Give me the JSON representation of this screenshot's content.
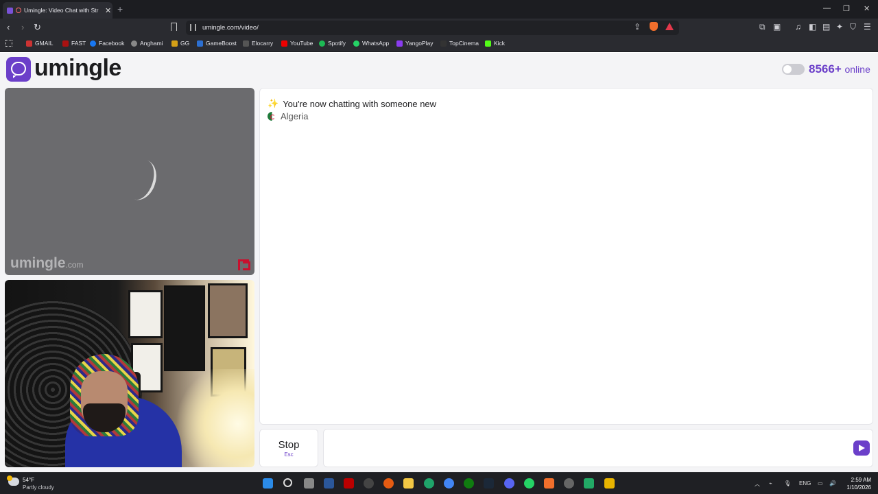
{
  "browser": {
    "tab_title": "Umingle: Video Chat with Str",
    "new_tab": "+",
    "url": "umingle.com/video/",
    "bookmarks": [
      "GMAIL",
      "FAST",
      "Facebook",
      "Anghami",
      "GG",
      "GameBoost",
      "Elocarry",
      "YouTube",
      "Spotify",
      "WhatsApp",
      "YangoPlay",
      "TopCinema",
      "Kick"
    ]
  },
  "site": {
    "logo_text": "umingle",
    "online_count": "8566+",
    "online_label": "online"
  },
  "video": {
    "watermark": "umingle",
    "watermark_domain": ".com"
  },
  "chat": {
    "system_message": "You're now chatting with someone new",
    "country": "Algeria",
    "stop_label": "Stop",
    "stop_key": "Esc",
    "input_value": ""
  },
  "taskbar": {
    "temperature": "54°F",
    "weather": "Partly cloudy",
    "language": "ENG",
    "time": "2:59 AM",
    "date": "1/10/2026"
  },
  "colors": {
    "brand": "#6b3fc9",
    "chrome_dark": "#2a2b30"
  }
}
